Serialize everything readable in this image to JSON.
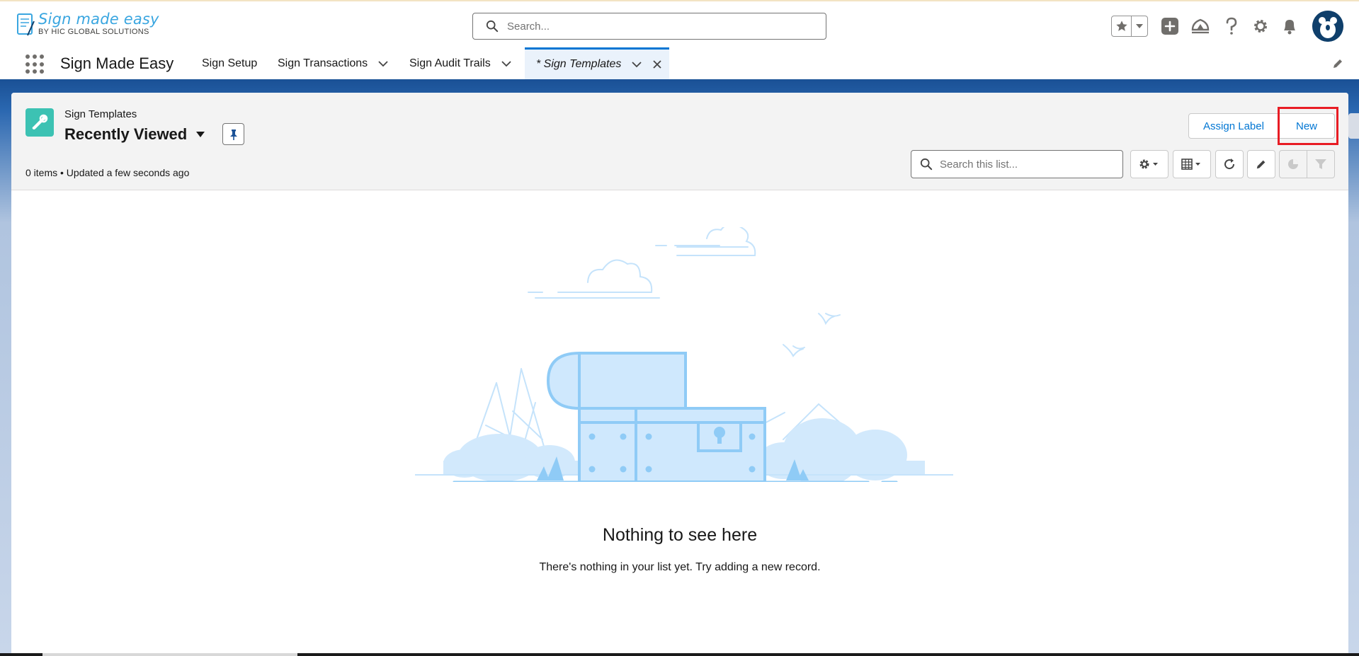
{
  "logo": {
    "title": "Sign made easy",
    "subtitle": "BY HIC GLOBAL SOLUTIONS"
  },
  "global_search": {
    "placeholder": "Search..."
  },
  "header_icons": [
    "favorites-star-icon",
    "chevron-down-icon",
    "global-actions-plus-icon",
    "trailhead-icon",
    "help-icon",
    "setup-gear-icon",
    "notifications-bell-icon",
    "user-avatar"
  ],
  "nav": {
    "app_name": "Sign Made Easy",
    "items": [
      {
        "label": "Sign Setup",
        "has_menu": false
      },
      {
        "label": "Sign Transactions",
        "has_menu": true
      },
      {
        "label": "Sign Audit Trails",
        "has_menu": true
      }
    ],
    "active_tab": {
      "label": "* Sign Templates"
    }
  },
  "list_view": {
    "object_label": "Sign Templates",
    "view_name": "Recently Viewed",
    "meta": "0 items • Updated a few seconds ago",
    "search_placeholder": "Search this list...",
    "buttons": {
      "assign_label": "Assign Label",
      "new": "New"
    },
    "toolbar_icons": [
      "list-settings-gear-icon",
      "display-as-table-icon",
      "refresh-icon",
      "edit-list-icon",
      "chart-icon",
      "filter-icon"
    ]
  },
  "empty_state": {
    "title": "Nothing to see here",
    "description": "There's nothing in your list yet. Try adding a new record."
  },
  "colors": {
    "brand": "#0176d3",
    "object_icon": "#3cc2b3",
    "highlight": "#e81c24",
    "nav_border": "#1b5297"
  }
}
